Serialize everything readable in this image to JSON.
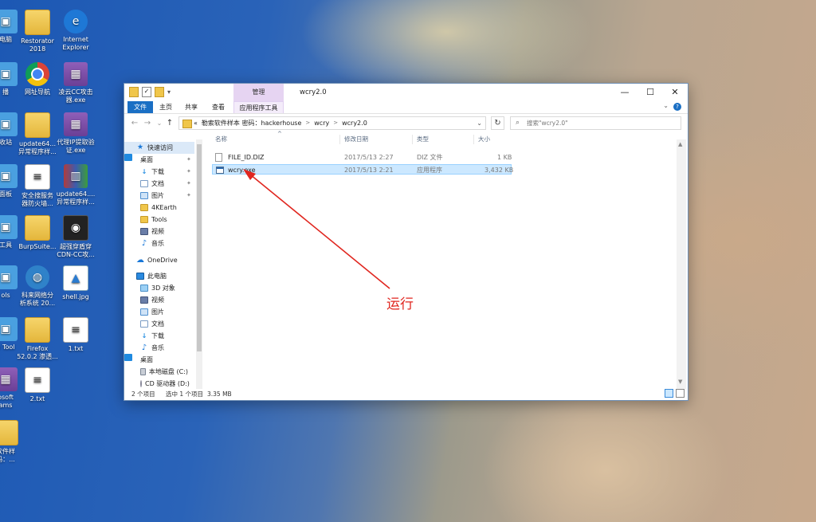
{
  "desktop": {
    "icons": [
      {
        "label": "电脑",
        "kind": "sys"
      },
      {
        "label": "Restorator\n2018",
        "kind": "folder"
      },
      {
        "label": "Internet\nExplorer",
        "kind": "ie"
      },
      {
        "label": "播",
        "kind": "sys"
      },
      {
        "label": "网址导航",
        "kind": "chrome"
      },
      {
        "label": "凌云CC攻击\n器.exe",
        "kind": "app"
      },
      {
        "label": "收站",
        "kind": "sys"
      },
      {
        "label": "update64...\n异常程序样...",
        "kind": "folder"
      },
      {
        "label": "代理IP提取验\n证.exe",
        "kind": "app"
      },
      {
        "label": "面板",
        "kind": "sys"
      },
      {
        "label": "安全搜服务\n器防火墙...",
        "kind": "file"
      },
      {
        "label": "update64....\n异常程序样...",
        "kind": "rar"
      },
      {
        "label": "工具",
        "kind": "sys"
      },
      {
        "label": "BurpSuite...",
        "kind": "folder"
      },
      {
        "label": "超强穿盾穿\nCDN-CC攻...",
        "kind": "dark"
      },
      {
        "label": "ols",
        "kind": "sys"
      },
      {
        "label": "科来网络分\n析系统 20...",
        "kind": "net"
      },
      {
        "label": "shell.jpg",
        "kind": "img"
      },
      {
        "label": "e Tool",
        "kind": "sys"
      },
      {
        "label": "Firefox\n52.0.2 渗透...",
        "kind": "folder"
      },
      {
        "label": "1.txt",
        "kind": "file"
      },
      {
        "label": "osoft\nams",
        "kind": "app"
      },
      {
        "label": "2.txt",
        "kind": "file"
      },
      {
        "label": "软件样\n码：...",
        "kind": "folder"
      }
    ]
  },
  "window": {
    "title": "wcry2.0",
    "context_tab": "管理",
    "controls": {
      "minimize": "—",
      "maximize": "☐",
      "close": "✕"
    },
    "ribbon_tabs": [
      "文件",
      "主页",
      "共享",
      "查看",
      "应用程序工具"
    ],
    "ribbon_expand": "⌄",
    "help": "?",
    "nav": {
      "back": "←",
      "forward": "→",
      "recent": "⌄",
      "up": "↑"
    },
    "address": {
      "crumbs": [
        "勒索软件样本 密码：hackerhouse",
        "wcry",
        "wcry2.0"
      ],
      "lead": "«",
      "dropdown": "⌄"
    },
    "refresh": "↻",
    "search": {
      "placeholder": "搜索\"wcry2.0\"",
      "icon": "⌕"
    }
  },
  "sidebar": {
    "items": [
      {
        "label": "快速访问",
        "icon": "star-icon",
        "sel": true
      },
      {
        "label": "桌面",
        "icon": "desktop-icon",
        "pin": true
      },
      {
        "label": "下载",
        "icon": "download-icon",
        "pin": true
      },
      {
        "label": "文档",
        "icon": "document-icon",
        "pin": true
      },
      {
        "label": "图片",
        "icon": "picture-icon",
        "pin": true
      },
      {
        "label": "4KEarth",
        "icon": "folder-icon"
      },
      {
        "label": "Tools",
        "icon": "folder-icon"
      },
      {
        "label": "视频",
        "icon": "video-icon"
      },
      {
        "label": "音乐",
        "icon": "music-icon"
      },
      {
        "label": "OneDrive",
        "icon": "cloud-icon"
      },
      {
        "label": "此电脑",
        "icon": "computer-icon"
      },
      {
        "label": "3D 对象",
        "icon": "cube-icon"
      },
      {
        "label": "视频",
        "icon": "video-icon"
      },
      {
        "label": "图片",
        "icon": "picture-icon"
      },
      {
        "label": "文档",
        "icon": "document-icon"
      },
      {
        "label": "下载",
        "icon": "download-icon"
      },
      {
        "label": "音乐",
        "icon": "music-icon"
      },
      {
        "label": "桌面",
        "icon": "desktop-icon"
      },
      {
        "label": "本地磁盘 (C:)",
        "icon": "disk-icon"
      },
      {
        "label": "CD 驱动器 (D:)",
        "icon": "cd-drive-icon"
      }
    ]
  },
  "filelist": {
    "columns": [
      "名称",
      "修改日期",
      "类型",
      "大小"
    ],
    "sort_glyph": "^",
    "rows": [
      {
        "name": "FILE_ID.DIZ",
        "date": "2017/5/13 2:27",
        "type": "DIZ 文件",
        "size": "1 KB",
        "selected": false
      },
      {
        "name": "wcry.exe",
        "date": "2017/5/13 2:21",
        "type": "应用程序",
        "size": "3,432 KB",
        "selected": true
      }
    ]
  },
  "status": {
    "count": "2 个项目",
    "selection": "选中 1 个项目",
    "size": "3.35 MB"
  },
  "annotation": {
    "text": "运行",
    "color": "#e0261f"
  }
}
